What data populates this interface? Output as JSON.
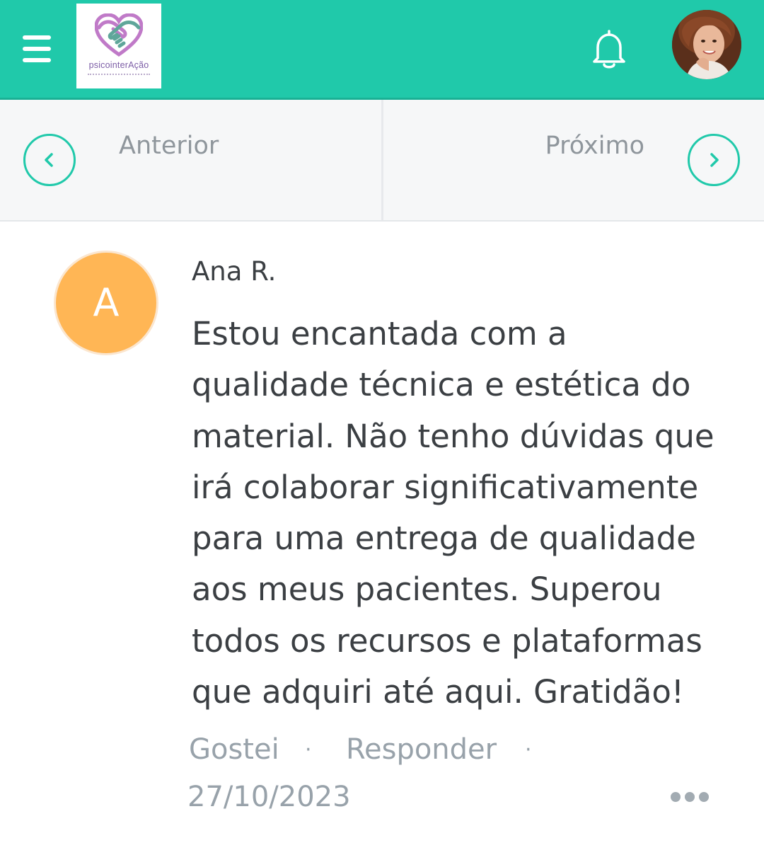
{
  "header": {
    "logo_text": "psicointerAção",
    "menu_icon": "hamburger-menu-icon",
    "bell_icon": "bell-icon",
    "colors": {
      "bar": "#20c9aa",
      "logo_text": "#7c5da6"
    }
  },
  "nav": {
    "prev_label": "Anterior",
    "next_label": "Próximo",
    "prev_icon": "chevron-left-icon",
    "next_icon": "chevron-right-icon"
  },
  "comment": {
    "avatar_letter": "A",
    "avatar_color": "#ffb655",
    "author": "Ana R.",
    "lines": [
      "Estou encantada com a",
      "qualidade técnica e estética do",
      "material. Não tenho dúvidas que",
      "irá colaborar significativamente",
      "para uma entrega de qualidade",
      "aos meus pacientes. Superou",
      "todos os recursos e plataformas",
      "que adquiri até aqui. Gratidão!"
    ],
    "like_label": "Gostei",
    "reply_label": "Responder",
    "separator": "·",
    "date": "27/10/2023",
    "more_icon": "more-dots-icon"
  }
}
